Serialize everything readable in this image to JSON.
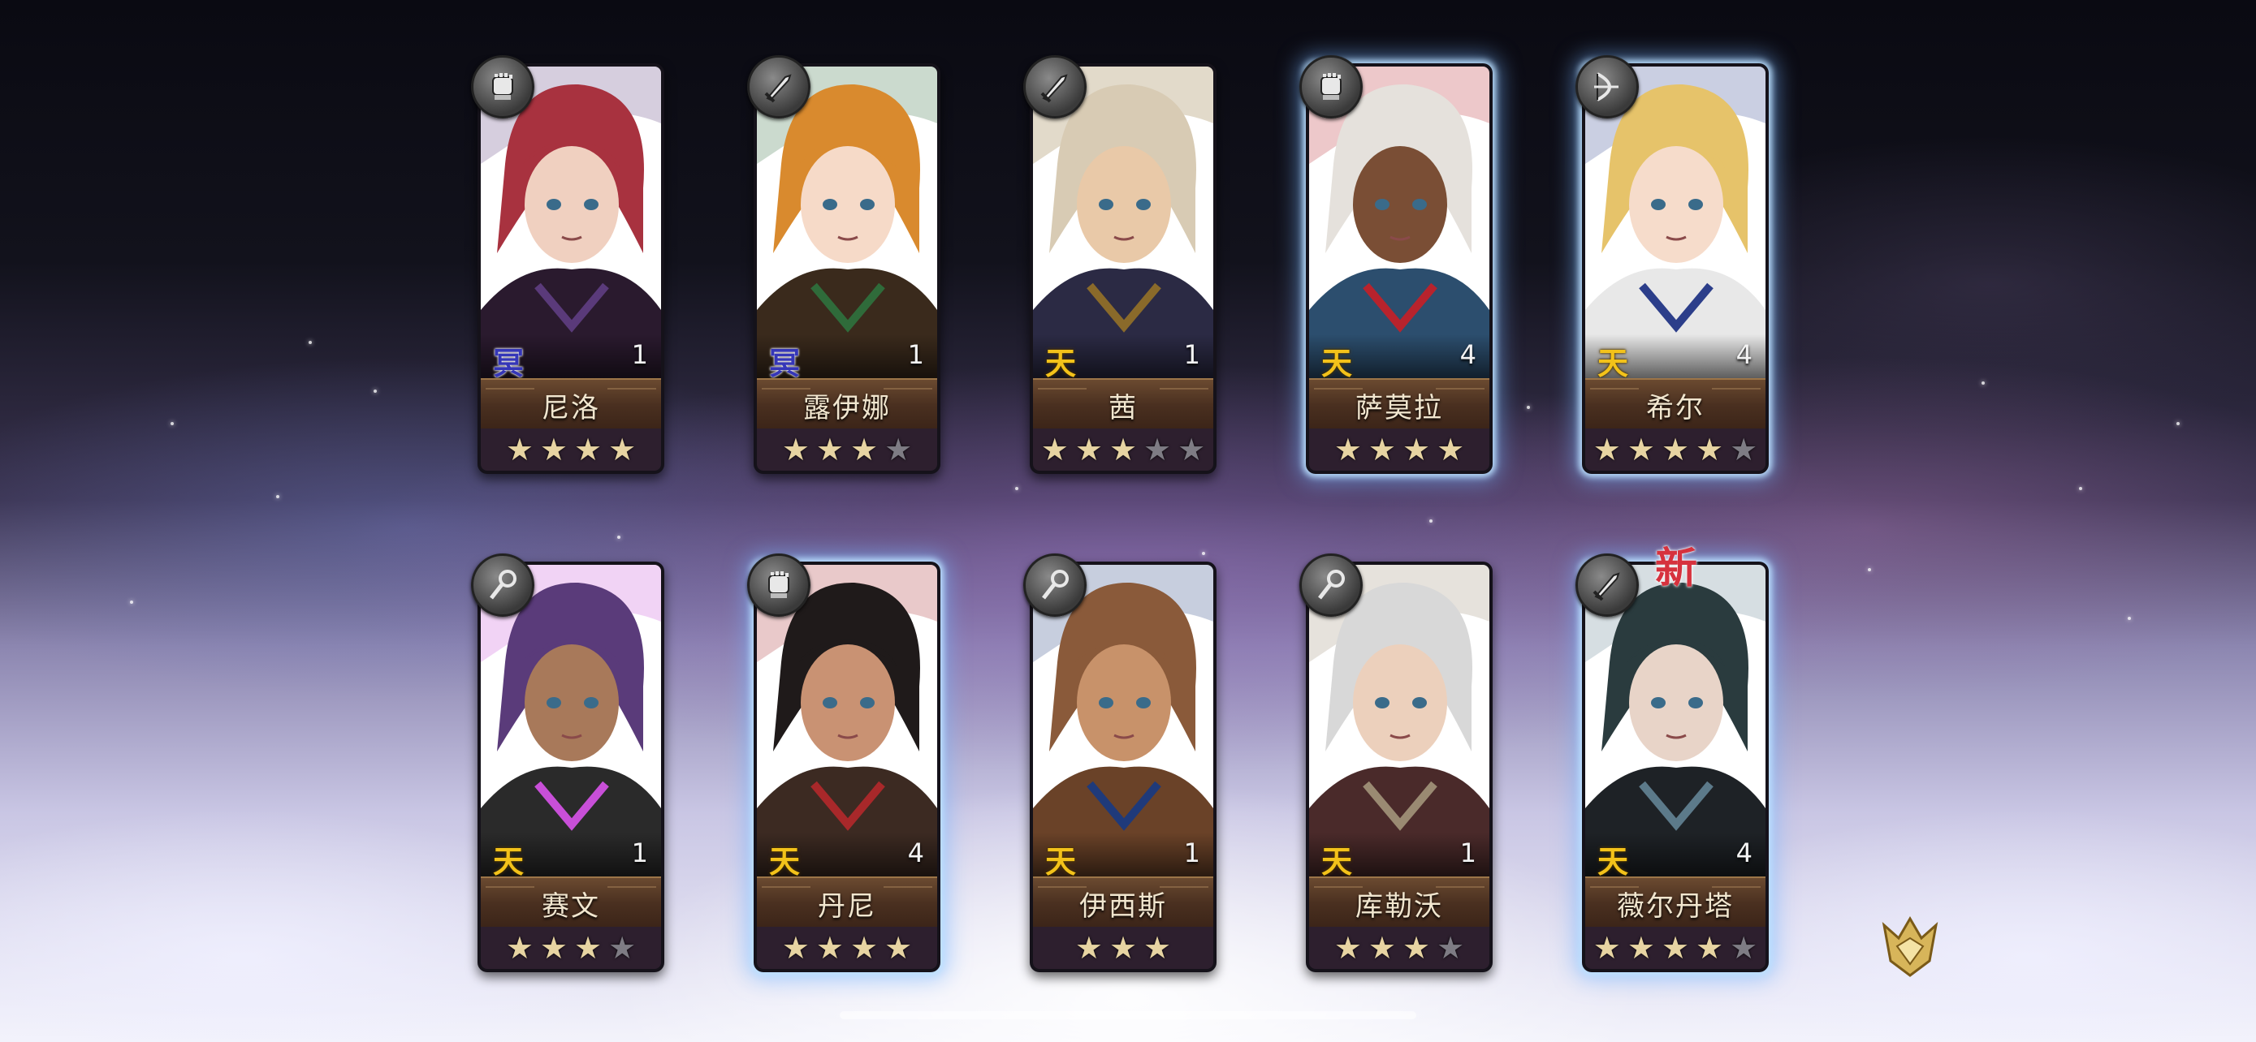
{
  "characters": [
    {
      "name": "尼洛",
      "level": "1",
      "element_badge": "冥",
      "element": "nether",
      "stars": 4,
      "max_stars": 4,
      "weapon_icon": "gauntlet-icon",
      "glow": false,
      "new_label": "",
      "portrait": {
        "hair": "#a8323f",
        "skin": "#f0d0c0",
        "outfit": "#2a1a2e",
        "accent": "#5a3a7a",
        "bg": "#ffffff"
      }
    },
    {
      "name": "露伊娜",
      "level": "1",
      "element_badge": "冥",
      "element": "nether",
      "stars": 3,
      "max_stars": 4,
      "weapon_icon": "sword-icon",
      "glow": false,
      "new_label": "",
      "portrait": {
        "hair": "#d98a2e",
        "skin": "#f6dac8",
        "outfit": "#3a2a1c",
        "accent": "#2f6b3a",
        "bg": "#ffffff"
      }
    },
    {
      "name": "茜",
      "level": "1",
      "element_badge": "天",
      "element": "heaven",
      "stars": 3,
      "max_stars": 5,
      "weapon_icon": "sword-icon",
      "glow": false,
      "new_label": "",
      "portrait": {
        "hair": "#d8cbb4",
        "skin": "#e9c9a8",
        "outfit": "#2b2a44",
        "accent": "#8a6a2a",
        "bg": "#ffffff"
      }
    },
    {
      "name": "萨莫拉",
      "level": "4",
      "element_badge": "天",
      "element": "heaven",
      "stars": 4,
      "max_stars": 4,
      "weapon_icon": "gauntlet-icon",
      "glow": true,
      "new_label": "",
      "portrait": {
        "hair": "#e5e1dc",
        "skin": "#7a4e35",
        "outfit": "#2c4e6e",
        "accent": "#b8232d",
        "bg": "#ffffff"
      }
    },
    {
      "name": "希尔",
      "level": "4",
      "element_badge": "天",
      "element": "heaven",
      "stars": 4,
      "max_stars": 5,
      "weapon_icon": "bow-icon",
      "glow": true,
      "new_label": "",
      "portrait": {
        "hair": "#e6c36a",
        "skin": "#f6dccb",
        "outfit": "#e8e8e8",
        "accent": "#2c3e8a",
        "bg": "#ffffff"
      }
    },
    {
      "name": "赛文",
      "level": "1",
      "element_badge": "天",
      "element": "heaven",
      "stars": 3,
      "max_stars": 4,
      "weapon_icon": "staff-icon",
      "glow": false,
      "new_label": "",
      "portrait": {
        "hair": "#5a3b7a",
        "skin": "#a8795a",
        "outfit": "#2a2a2a",
        "accent": "#c84fd8",
        "bg": "#ffffff"
      }
    },
    {
      "name": "丹尼",
      "level": "4",
      "element_badge": "天",
      "element": "heaven",
      "stars": 4,
      "max_stars": 4,
      "weapon_icon": "gauntlet-icon",
      "glow": true,
      "new_label": "",
      "portrait": {
        "hair": "#1f1a1a",
        "skin": "#c99273",
        "outfit": "#3c2a22",
        "accent": "#a8282a",
        "bg": "#ffffff"
      }
    },
    {
      "name": "伊西斯",
      "level": "1",
      "element_badge": "天",
      "element": "heaven",
      "stars": 3,
      "max_stars": 3,
      "weapon_icon": "staff-icon",
      "glow": false,
      "new_label": "",
      "portrait": {
        "hair": "#8a5a3a",
        "skin": "#c8926a",
        "outfit": "#6a4228",
        "accent": "#1f3a7a",
        "bg": "#ffffff"
      }
    },
    {
      "name": "库勒沃",
      "level": "1",
      "element_badge": "天",
      "element": "heaven",
      "stars": 3,
      "max_stars": 4,
      "weapon_icon": "staff-icon",
      "glow": false,
      "new_label": "",
      "portrait": {
        "hair": "#d8d8d8",
        "skin": "#ecd0bc",
        "outfit": "#4a2a2a",
        "accent": "#9a8a72",
        "bg": "#ffffff"
      }
    },
    {
      "name": "薇尔丹塔",
      "level": "4",
      "element_badge": "天",
      "element": "heaven",
      "stars": 4,
      "max_stars": 5,
      "weapon_icon": "sword-icon",
      "glow": true,
      "new_label": "新",
      "portrait": {
        "hair": "#2a3b3e",
        "skin": "#e8d4c8",
        "outfit": "#1e2226",
        "accent": "#5c7a8a",
        "bg": "#ffffff"
      }
    }
  ],
  "colors": {
    "heaven": "#f3c21a",
    "nether": "#3536b8",
    "star_on": "#e7d4a2",
    "star_off": "#7e7c84",
    "new_label": "#d6323e"
  }
}
